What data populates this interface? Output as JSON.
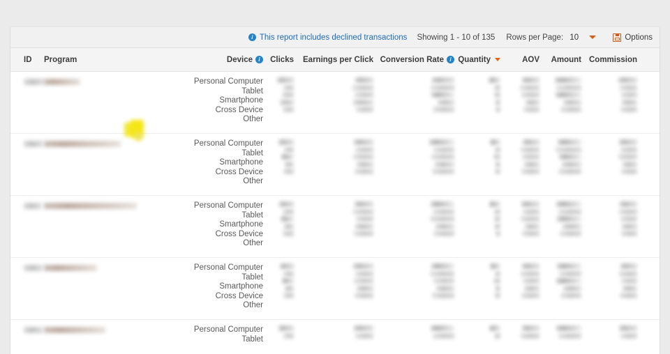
{
  "toolbar": {
    "note": "This report includes declined transactions",
    "note_icon": "info-icon",
    "showing": "Showing 1 - 10 of 135",
    "rows_per_page_label": "Rows per Page:",
    "rows_per_page_value": "10",
    "rows_per_page_caret": "chevron-down-icon",
    "options_label": "Options",
    "options_icon": "save-floppy-icon",
    "link_color": "#1e6bb8",
    "accent_color": "#d45f18"
  },
  "table": {
    "columns": [
      {
        "key": "id",
        "label": "ID",
        "align": "left",
        "info": false,
        "sorted": false
      },
      {
        "key": "program",
        "label": "Program",
        "align": "left",
        "info": false,
        "sorted": false
      },
      {
        "key": "device",
        "label": "Device",
        "align": "right",
        "info": true,
        "sorted": false
      },
      {
        "key": "clicks",
        "label": "Clicks",
        "align": "right",
        "info": false,
        "sorted": false
      },
      {
        "key": "epc",
        "label": "Earnings per Click",
        "align": "right",
        "info": false,
        "sorted": false
      },
      {
        "key": "cvr",
        "label": "Conversion Rate",
        "align": "right",
        "info": true,
        "sorted": false
      },
      {
        "key": "quantity",
        "label": "Quantity",
        "align": "right",
        "info": false,
        "sorted": true
      },
      {
        "key": "aov",
        "label": "AOV",
        "align": "right",
        "info": false,
        "sorted": false
      },
      {
        "key": "amount",
        "label": "Amount",
        "align": "right",
        "info": false,
        "sorted": false
      },
      {
        "key": "commission",
        "label": "Commission",
        "align": "right",
        "info": false,
        "sorted": false
      }
    ],
    "device_breakdown": [
      "Personal Computer",
      "Tablet",
      "Smartphone",
      "Cross Device",
      "Other"
    ],
    "rows": [
      {
        "id": "redacted",
        "program": "redacted",
        "devices": [
          "Personal Computer",
          "Tablet",
          "Smartphone",
          "Cross Device",
          "Other"
        ],
        "values": "redacted"
      },
      {
        "id": "redacted",
        "program": "redacted",
        "devices": [
          "Personal Computer",
          "Tablet",
          "Smartphone",
          "Cross Device",
          "Other"
        ],
        "values": "redacted"
      },
      {
        "id": "redacted",
        "program": "redacted",
        "devices": [
          "Personal Computer",
          "Tablet",
          "Smartphone",
          "Cross Device",
          "Other"
        ],
        "values": "redacted"
      },
      {
        "id": "redacted",
        "program": "redacted",
        "devices": [
          "Personal Computer",
          "Tablet",
          "Smartphone",
          "Cross Device",
          "Other"
        ],
        "values": "redacted"
      },
      {
        "id": "redacted",
        "program": "redacted",
        "devices": [
          "Personal Computer",
          "Tablet"
        ],
        "values": "redacted"
      }
    ]
  },
  "overlay": {
    "cursor": "yellow-highlight-cursor"
  }
}
